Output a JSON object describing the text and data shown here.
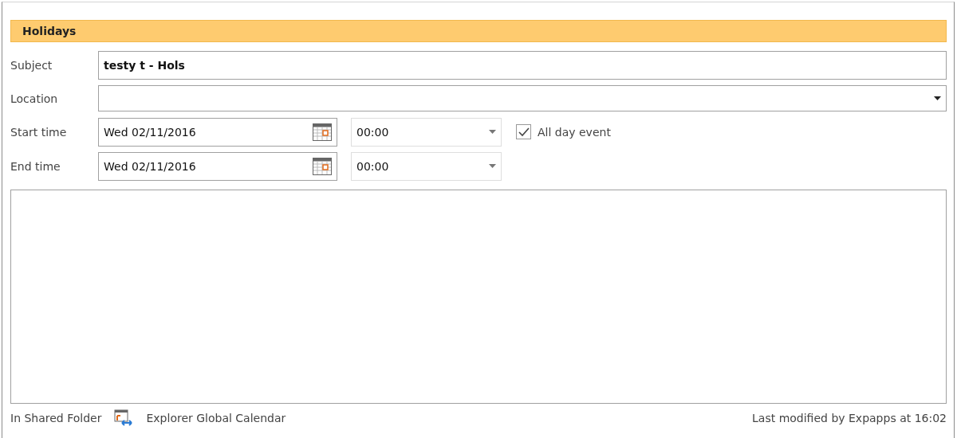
{
  "category_banner": "Holidays",
  "subject": {
    "label": "Subject",
    "value": "testy t - Hols"
  },
  "location": {
    "label": "Location"
  },
  "start_time": {
    "label": "Start time",
    "date": "Wed 02/11/2016",
    "time": "00:00"
  },
  "end_time": {
    "label": "End time",
    "date": "Wed 02/11/2016",
    "time": "00:00"
  },
  "all_day_event": {
    "label": "All day event",
    "checked": true
  },
  "footer": {
    "folder_label": "In Shared Folder",
    "folder_name": "Explorer Global Calendar",
    "modified": "Last modified by Expapps at 16:02"
  }
}
